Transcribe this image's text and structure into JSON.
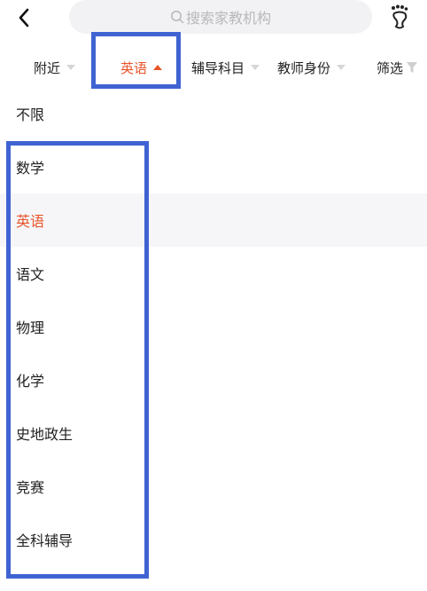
{
  "header": {
    "search_placeholder": "搜索家教机构"
  },
  "filters": [
    {
      "label": "附近",
      "active": false
    },
    {
      "label": "英语",
      "active": true
    },
    {
      "label": "辅导科目",
      "active": false
    },
    {
      "label": "教师身份",
      "active": false
    },
    {
      "label": "筛选",
      "active": false
    }
  ],
  "options": [
    {
      "label": "不限",
      "selected": false
    },
    {
      "label": "数学",
      "selected": false
    },
    {
      "label": "英语",
      "selected": true
    },
    {
      "label": "语文",
      "selected": false
    },
    {
      "label": "物理",
      "selected": false
    },
    {
      "label": "化学",
      "selected": false
    },
    {
      "label": "史地政生",
      "selected": false
    },
    {
      "label": "竞赛",
      "selected": false
    },
    {
      "label": "全科辅导",
      "selected": false
    }
  ],
  "colors": {
    "accent": "#e8552c",
    "highlight_box": "#3f63d2",
    "search_bg": "#f2f2f4",
    "selected_row_bg": "#f6f6f8"
  }
}
